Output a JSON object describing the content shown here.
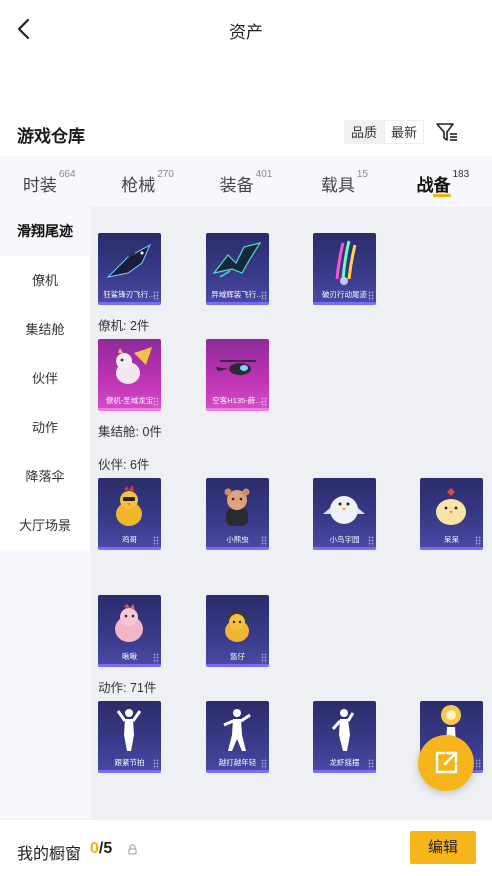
{
  "header": {
    "title": "资产"
  },
  "warehouse": {
    "title": "游戏仓库"
  },
  "sort": {
    "options": [
      "品质",
      "最新"
    ],
    "active": "品质"
  },
  "tabs": [
    {
      "label": "时装",
      "count": "664"
    },
    {
      "label": "枪械",
      "count": "270"
    },
    {
      "label": "装备",
      "count": "401"
    },
    {
      "label": "载具",
      "count": "15"
    },
    {
      "label": "战备",
      "count": "183"
    }
  ],
  "active_tab": "战备",
  "sidebar": {
    "items": [
      {
        "label": "滑翔尾迹"
      },
      {
        "label": "僚机"
      },
      {
        "label": "集结舱"
      },
      {
        "label": "伙伴"
      },
      {
        "label": "动作"
      },
      {
        "label": "降落伞"
      },
      {
        "label": "大厅场景"
      }
    ]
  },
  "sections": {
    "wingman": {
      "label": "僚机: 2件"
    },
    "pod": {
      "label": "集结舱: 0件"
    },
    "partner": {
      "label": "伙伴: 6件"
    },
    "emote": {
      "label": "动作: 71件"
    }
  },
  "cards": {
    "trail": [
      {
        "name": "狂鲨锋刃飞行…",
        "color": "blue",
        "icon": "shark-glider-icon"
      },
      {
        "name": "异域辉装飞行…",
        "color": "blue",
        "icon": "winged-glider-icon"
      },
      {
        "name": "破刃行动尾迹",
        "color": "blue",
        "icon": "trail-effect-icon"
      }
    ],
    "wingman": [
      {
        "name": "僚机-圣域龙宝",
        "color": "pink",
        "icon": "dragon-pet-icon"
      },
      {
        "name": "空客H135-薛…",
        "color": "pink",
        "icon": "helicopter-icon"
      }
    ],
    "partner": [
      {
        "name": "鸡哥",
        "color": "blue",
        "icon": "chicken-partner-icon"
      },
      {
        "name": "小熊虫",
        "color": "blue",
        "icon": "red-panda-partner-icon"
      },
      {
        "name": "小鸟宇园",
        "color": "blue",
        "icon": "bird-partner-icon"
      },
      {
        "name": "呆呆",
        "color": "blue",
        "icon": "chick-partner-icon"
      },
      {
        "name": "啾啾",
        "color": "blue",
        "icon": "pink-bird-partner-icon"
      },
      {
        "name": "盔仔",
        "color": "blue",
        "icon": "helmet-duck-partner-icon"
      }
    ],
    "emote": [
      {
        "name": "跟紧节拍",
        "color": "blue",
        "icon": "dance-pose-icon"
      },
      {
        "name": "越打越年轻",
        "color": "blue",
        "icon": "dance-pose-icon"
      },
      {
        "name": "龙虾摇摆",
        "color": "blue",
        "icon": "dance-pose-icon"
      },
      {
        "name": "",
        "color": "blue",
        "icon": "golden-effect-icon"
      }
    ]
  },
  "showcase": {
    "label": "我的橱窗",
    "used": "0",
    "separator": "/",
    "total": "5"
  },
  "buttons": {
    "edit": "编辑"
  },
  "colors": {
    "accent": "#f7b51c",
    "rare_blue": "#3a3b8a",
    "epic_pink": "#c035b5"
  }
}
